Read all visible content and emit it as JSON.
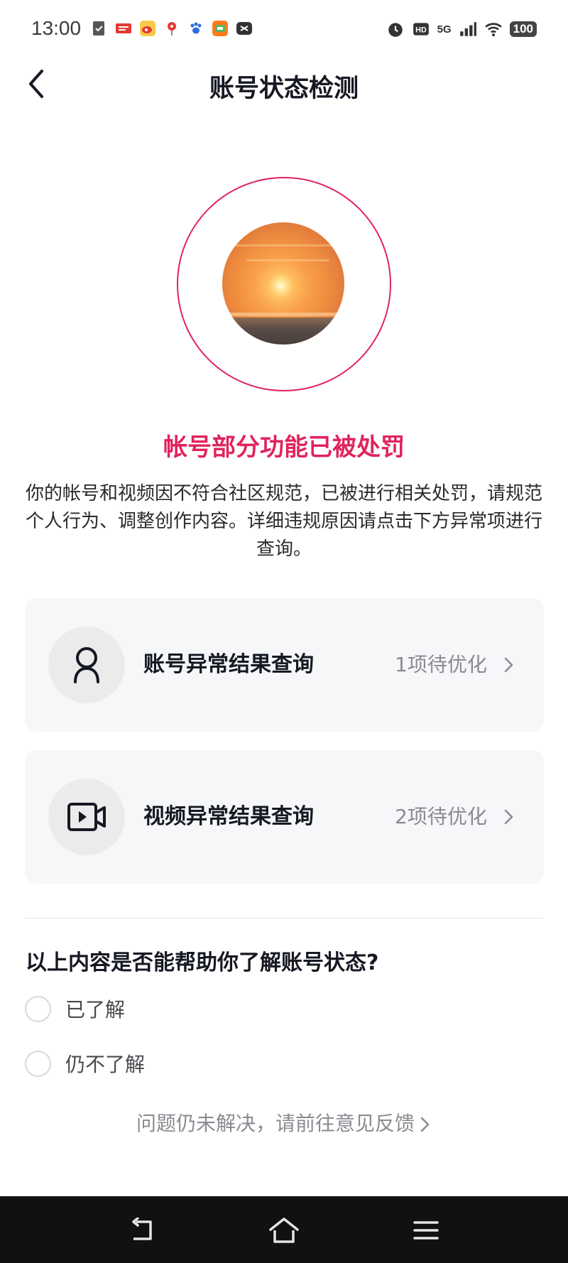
{
  "status_bar": {
    "time": "13:00",
    "network": "5G",
    "battery": "100",
    "left_icons": [
      "check-icon",
      "toutiao-icon",
      "weibo-icon",
      "map-pin-icon",
      "paw-icon",
      "taobao-icon",
      "cc-icon"
    ],
    "right_icons": [
      "alarm-icon",
      "hd-icon",
      "signal-icon",
      "wifi-icon",
      "battery-icon"
    ]
  },
  "nav": {
    "title": "账号状态检测"
  },
  "status": {
    "headline": "帐号部分功能已被处罚",
    "description": "你的帐号和视频因不符合社区规范，已被进行相关处罚，请规范个人行为、调整创作内容。详细违规原因请点击下方异常项进行查询。",
    "accent_color": "#e0245e"
  },
  "cards": [
    {
      "label": "账号异常结果查询",
      "count": "1项待优化",
      "icon": "user-icon"
    },
    {
      "label": "视频异常结果查询",
      "count": "2项待优化",
      "icon": "video-camera-icon"
    }
  ],
  "survey": {
    "question": "以上内容是否能帮助你了解账号状态?",
    "options": [
      "已了解",
      "仍不了解"
    ]
  },
  "feedback": {
    "text": "问题仍未解决，请前往意见反馈"
  }
}
